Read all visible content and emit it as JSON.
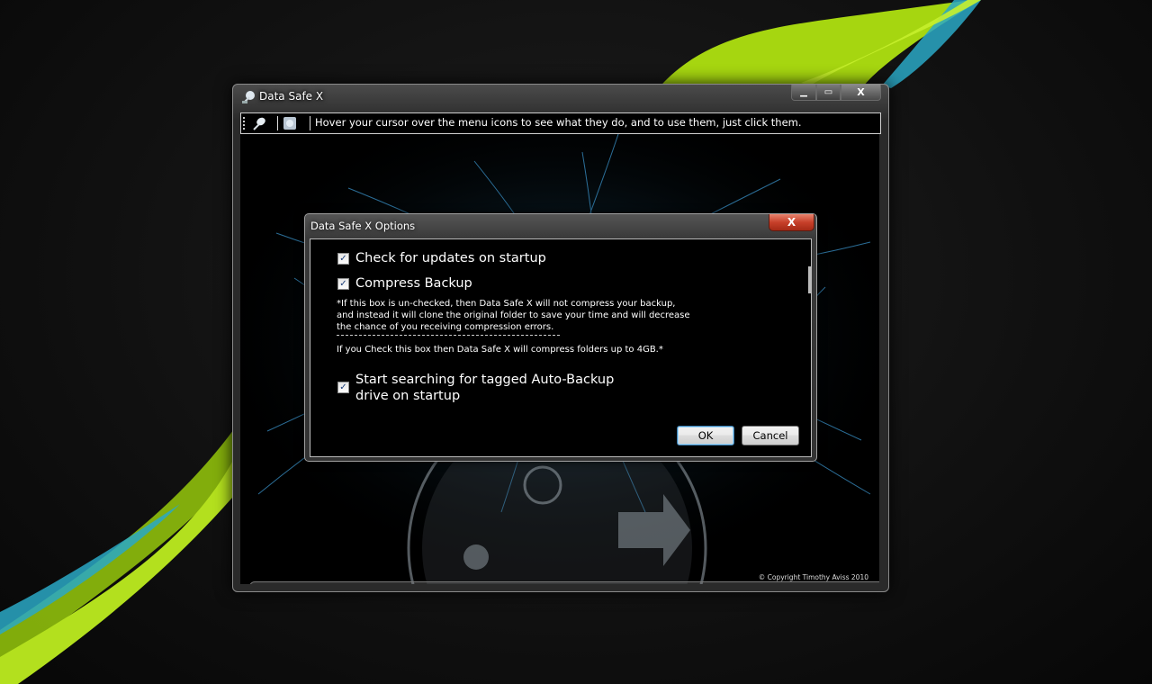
{
  "window": {
    "title": "Data Safe X",
    "controls": {
      "minimize": "▁",
      "maximize": "▭",
      "close": "X"
    }
  },
  "toolbar": {
    "buttons": [
      {
        "icon": "satellite-dish-icon"
      },
      {
        "icon": "disk-icon"
      }
    ],
    "hint": "Hover your cursor over the menu icons to see what they do, and to use them, just click them."
  },
  "footer": {
    "copyright": "© Copyright Timothy Aviss 2010"
  },
  "dialog": {
    "title": "Data Safe X Options",
    "close_label": "X",
    "options": [
      {
        "label": "Check for updates on startup",
        "checked": true
      },
      {
        "label": "Compress Backup",
        "checked": true
      },
      {
        "label": "Start searching for tagged Auto-Backup",
        "label_line2": "drive on startup",
        "checked": true
      }
    ],
    "compress_note": {
      "line1": "*If this box is un-checked, then Data Safe X will not compress your backup,",
      "line2": "and instead it will clone the original folder to save your time and will decrease",
      "line3": "the chance of you receiving compression errors.",
      "line4": "If you Check this box then Data Safe X will compress folders up to 4GB.*"
    },
    "ok_label": "OK",
    "cancel_label": "Cancel"
  },
  "colors": {
    "swoosh_green": "#a6d610",
    "swoosh_cyan": "#2aa8c6",
    "art_blue": "#3d9bd6"
  }
}
